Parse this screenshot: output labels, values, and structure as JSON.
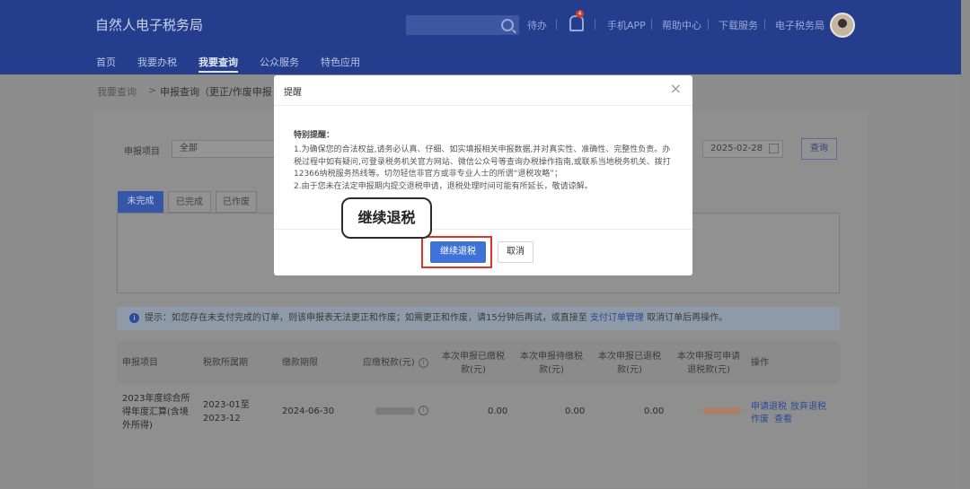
{
  "header": {
    "site_title": "自然人电子税务局",
    "todo": "待办",
    "badge_count": "4",
    "links": [
      "手机APP",
      "帮助中心",
      "下载服务",
      "电子税务局"
    ]
  },
  "nav": [
    "首页",
    "我要办税",
    "我要查询",
    "公众服务",
    "特色应用"
  ],
  "breadcrumb": {
    "root": "我要查询",
    "sep": ">",
    "current": "申报查询（更正/作废申报"
  },
  "filters": {
    "item_label": "申报项目",
    "item_value": "全部",
    "date_value": "2025-02-28",
    "query_button": "查询"
  },
  "tabs": [
    "未完成",
    "已完成",
    "已作废"
  ],
  "tip": {
    "icon": "i",
    "text": "提示：如您存在未支付完成的订单，则该申报表无法更正和作废；如需更正和作废，请15分钟后再试，或直接至",
    "link": "支付订单管理",
    "after": "取消订单后再操作。"
  },
  "table": {
    "headers": [
      "申报项目",
      "税款所属期",
      "缴款期限",
      "应缴税款(元)",
      "本次申报已缴税款(元)",
      "本次申报待缴税款(元)",
      "本次申报已退税款(元)",
      "本次申报可申请退税款(元)",
      "操作"
    ],
    "row": {
      "item": "2023年度综合所得年度汇算(含境外所得)",
      "period": "2023-01至2023-12",
      "deadline": "2024-06-30",
      "paid": "0.00",
      "pending": "0.00",
      "refunded": "0.00",
      "actions": [
        "申请退税",
        "放弃退税",
        "作废",
        "查看"
      ]
    }
  },
  "modal": {
    "title": "提醒",
    "close": "×",
    "subtitle": "特别提醒：",
    "para1": "1.为确保您的合法权益,请务必认真、仔细、如实填报相关申报数据,并对真实性、准确性、完整性负责。办税过程中如有疑问,可登录税务机关官方网站、微信公众号等查询办税操作指南,或联系当地税务机关、拨打12366纳税服务热线等。切勿轻信非官方或非专业人士的所谓“退税攻略”；",
    "para2": "2.由于您未在法定申报期内提交退税申请，退税处理时间可能有所延长，敬请谅解。",
    "confirm": "继续退税",
    "cancel": "取消"
  },
  "annotation": {
    "callout": "继续退税",
    "highlight_color": "#e0342a"
  },
  "colors": {
    "header": "#243d8d",
    "primary": "#3f72d8"
  }
}
